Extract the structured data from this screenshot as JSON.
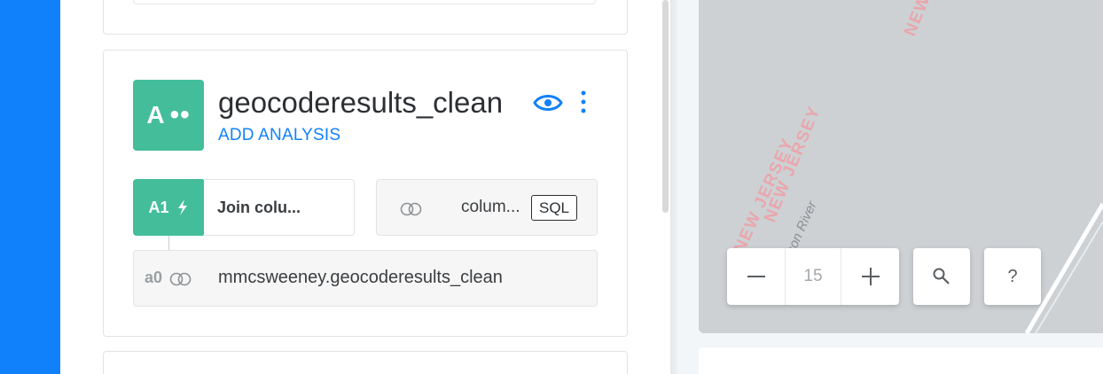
{
  "colors": {
    "accent": "#1181fb",
    "layer_green": "#44bd9b",
    "map_label_pink": "#e9a7ad"
  },
  "layer": {
    "badge_letter": "A",
    "badge_dots": "••",
    "title": "geocoderesults_clean",
    "add_analysis_label": "ADD ANALYSIS",
    "visibility_icon": "eye-icon",
    "options_icon": "kebab-icon"
  },
  "analysis_node": {
    "id": "A1",
    "icon": "lightning-icon",
    "label": "Join colu..."
  },
  "parameter": {
    "toggle_icon": "toggle-icon",
    "label": "colum...",
    "chip_label": "SQL"
  },
  "source": {
    "id": "a0",
    "toggle_icon": "toggle-icon",
    "name": "mmcsweeney.geocoderesults_clean"
  },
  "map": {
    "labels": [
      "NEW JERSEY",
      "NEW JERSEY",
      "NEW"
    ],
    "river_label": "dson River",
    "zoom_out_icon": "minus-icon",
    "zoom_level": "15",
    "zoom_in_icon": "plus-icon",
    "search_icon": "search-icon",
    "help_label": "?"
  }
}
